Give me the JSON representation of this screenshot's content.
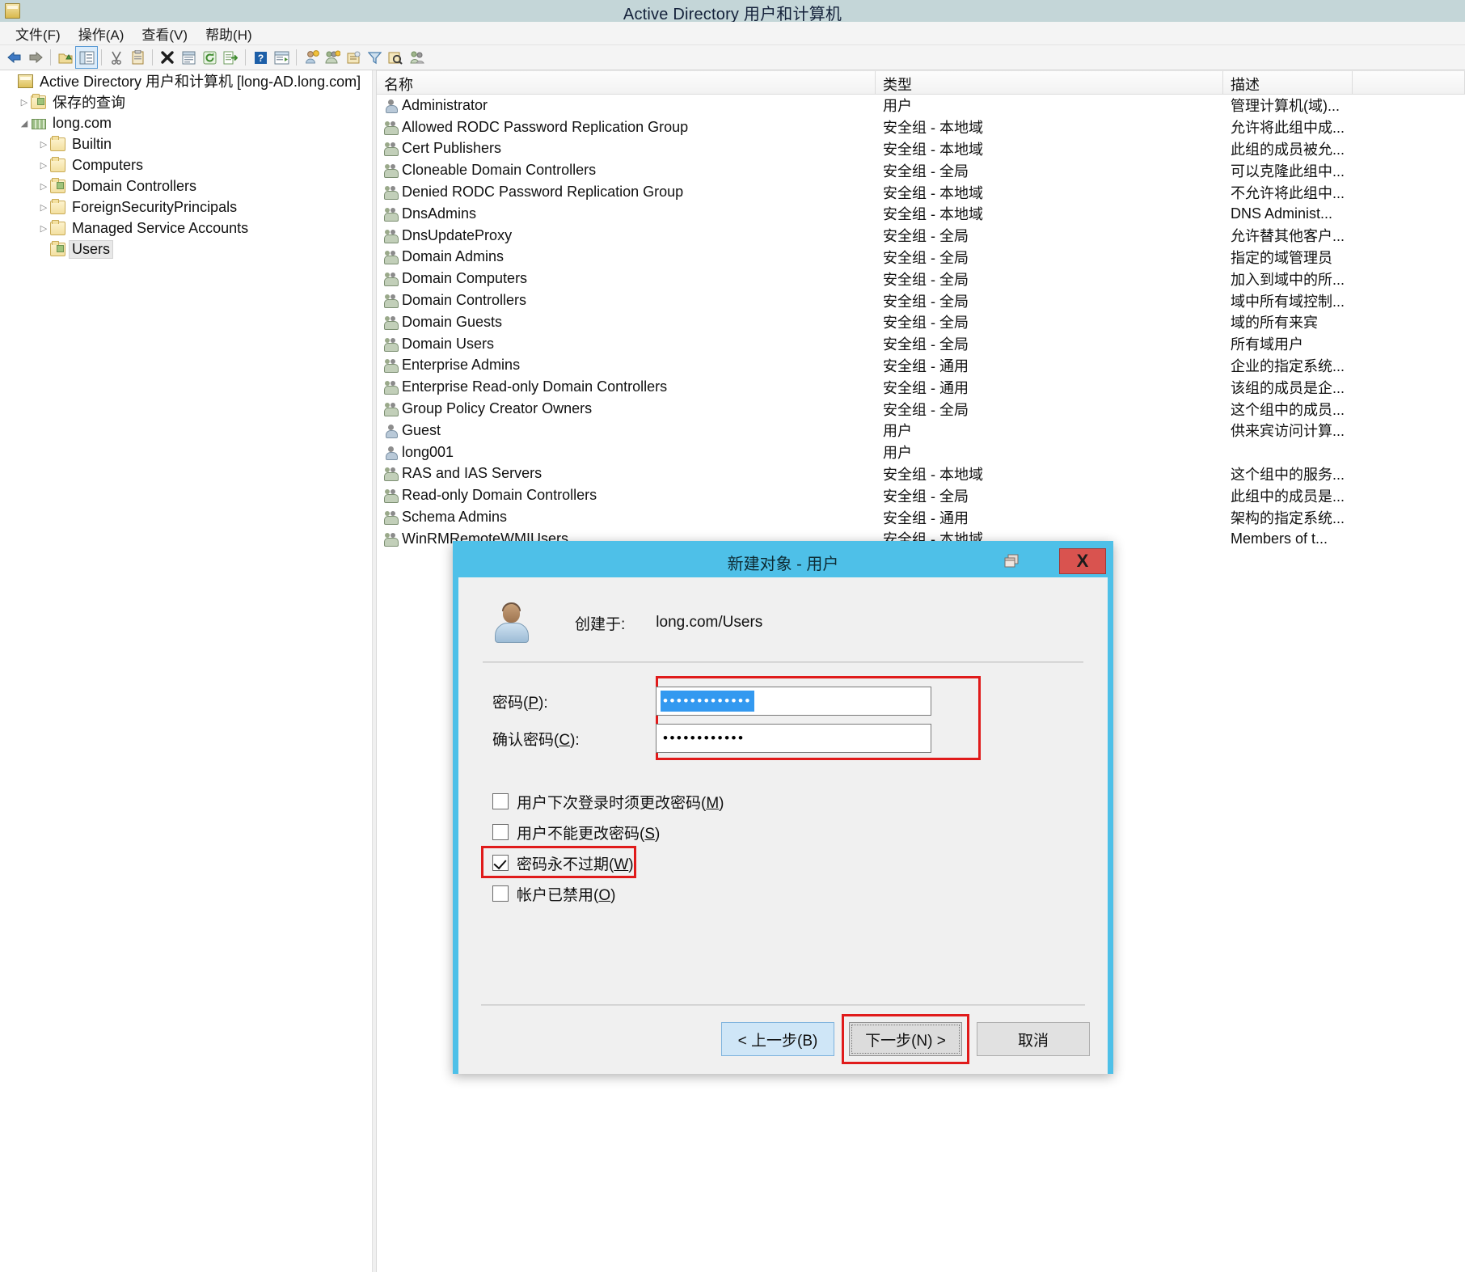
{
  "window": {
    "title": "Active Directory 用户和计算机",
    "icon": "console-icon"
  },
  "menubar": {
    "items": [
      {
        "label": "文件(F)",
        "name": "menu-file"
      },
      {
        "label": "操作(A)",
        "name": "menu-action"
      },
      {
        "label": "查看(V)",
        "name": "menu-view"
      },
      {
        "label": "帮助(H)",
        "name": "menu-help"
      }
    ]
  },
  "toolbar": {
    "buttons": [
      {
        "name": "back-icon",
        "title": "后退"
      },
      {
        "name": "forward-icon",
        "title": "前进"
      },
      {
        "name": "up-one-level-icon",
        "title": "向上一级"
      },
      {
        "name": "show-hide-tree-icon",
        "title": "显示/隐藏控制台树"
      },
      {
        "name": "cut-icon",
        "title": "剪切"
      },
      {
        "name": "copy-icon",
        "title": "复制"
      },
      {
        "name": "delete-icon",
        "title": "删除"
      },
      {
        "name": "properties-icon",
        "title": "属性"
      },
      {
        "name": "refresh-icon",
        "title": "刷新"
      },
      {
        "name": "export-list-icon",
        "title": "导出列表"
      },
      {
        "name": "help-icon",
        "title": "帮助"
      },
      {
        "name": "show-details-icon",
        "title": "显示详细信息"
      },
      {
        "name": "new-user-icon",
        "title": "新建用户"
      },
      {
        "name": "new-group-icon",
        "title": "新建组"
      },
      {
        "name": "new-ou-icon",
        "title": "新建组织单位"
      },
      {
        "name": "filter-icon",
        "title": "筛选"
      },
      {
        "name": "find-icon",
        "title": "查找"
      },
      {
        "name": "delegate-icon",
        "title": "委派控制"
      }
    ]
  },
  "tree": {
    "nodes": [
      {
        "label": "Active Directory 用户和计算机 [long-AD.long.com]",
        "indent": 0,
        "twist": "",
        "icon": "console",
        "selected": false,
        "name": "tree-node-root"
      },
      {
        "label": "保存的查询",
        "indent": 1,
        "twist": "▷",
        "icon": "folder special",
        "selected": false,
        "name": "tree-node-saved-queries"
      },
      {
        "label": "long.com",
        "indent": 1,
        "twist": "◢",
        "icon": "domain",
        "selected": false,
        "name": "tree-node-domain"
      },
      {
        "label": "Builtin",
        "indent": 2,
        "twist": "▷",
        "icon": "folder",
        "selected": false,
        "name": "tree-node-builtin"
      },
      {
        "label": "Computers",
        "indent": 2,
        "twist": "▷",
        "icon": "folder",
        "selected": false,
        "name": "tree-node-computers"
      },
      {
        "label": "Domain Controllers",
        "indent": 2,
        "twist": "▷",
        "icon": "folder special",
        "selected": false,
        "name": "tree-node-domain-controllers"
      },
      {
        "label": "ForeignSecurityPrincipals",
        "indent": 2,
        "twist": "▷",
        "icon": "folder",
        "selected": false,
        "name": "tree-node-foreign-security-principals"
      },
      {
        "label": "Managed Service Accounts",
        "indent": 2,
        "twist": "▷",
        "icon": "folder",
        "selected": false,
        "name": "tree-node-managed-service-accounts"
      },
      {
        "label": "Users",
        "indent": 2,
        "twist": "",
        "icon": "folder special",
        "selected": true,
        "name": "tree-node-users"
      }
    ]
  },
  "list": {
    "columns": [
      {
        "label": "名称",
        "name": "column-header-name"
      },
      {
        "label": "类型",
        "name": "column-header-type"
      },
      {
        "label": "描述",
        "name": "column-header-description"
      }
    ],
    "rows": [
      {
        "name": "Administrator",
        "icon": "user",
        "type": "用户",
        "desc": "管理计算机(域)..."
      },
      {
        "name": "Allowed RODC Password Replication Group",
        "icon": "group",
        "type": "安全组 - 本地域",
        "desc": "允许将此组中成..."
      },
      {
        "name": "Cert Publishers",
        "icon": "group",
        "type": "安全组 - 本地域",
        "desc": "此组的成员被允..."
      },
      {
        "name": "Cloneable Domain Controllers",
        "icon": "group",
        "type": "安全组 - 全局",
        "desc": "可以克隆此组中..."
      },
      {
        "name": "Denied RODC Password Replication Group",
        "icon": "group",
        "type": "安全组 - 本地域",
        "desc": "不允许将此组中..."
      },
      {
        "name": "DnsAdmins",
        "icon": "group",
        "type": "安全组 - 本地域",
        "desc": "DNS Administ..."
      },
      {
        "name": "DnsUpdateProxy",
        "icon": "group",
        "type": "安全组 - 全局",
        "desc": "允许替其他客户..."
      },
      {
        "name": "Domain Admins",
        "icon": "group",
        "type": "安全组 - 全局",
        "desc": "指定的域管理员"
      },
      {
        "name": "Domain Computers",
        "icon": "group",
        "type": "安全组 - 全局",
        "desc": "加入到域中的所..."
      },
      {
        "name": "Domain Controllers",
        "icon": "group",
        "type": "安全组 - 全局",
        "desc": "域中所有域控制..."
      },
      {
        "name": "Domain Guests",
        "icon": "group",
        "type": "安全组 - 全局",
        "desc": "域的所有来宾"
      },
      {
        "name": "Domain Users",
        "icon": "group",
        "type": "安全组 - 全局",
        "desc": "所有域用户"
      },
      {
        "name": "Enterprise Admins",
        "icon": "group",
        "type": "安全组 - 通用",
        "desc": "企业的指定系统..."
      },
      {
        "name": "Enterprise Read-only Domain Controllers",
        "icon": "group",
        "type": "安全组 - 通用",
        "desc": "该组的成员是企..."
      },
      {
        "name": "Group Policy Creator Owners",
        "icon": "group",
        "type": "安全组 - 全局",
        "desc": "这个组中的成员..."
      },
      {
        "name": "Guest",
        "icon": "user",
        "type": "用户",
        "desc": "供来宾访问计算..."
      },
      {
        "name": "long001",
        "icon": "user",
        "type": "用户",
        "desc": ""
      },
      {
        "name": "RAS and IAS Servers",
        "icon": "group",
        "type": "安全组 - 本地域",
        "desc": "这个组中的服务..."
      },
      {
        "name": "Read-only Domain Controllers",
        "icon": "group",
        "type": "安全组 - 全局",
        "desc": "此组中的成员是..."
      },
      {
        "name": "Schema Admins",
        "icon": "group",
        "type": "安全组 - 通用",
        "desc": "架构的指定系统..."
      },
      {
        "name": "WinRMRemoteWMIUsers__",
        "icon": "group",
        "type": "安全组 - 本地域",
        "desc": "Members of t..."
      }
    ]
  },
  "dialog": {
    "title": "新建对象 - 用户",
    "restore_icon": "restore-icon",
    "close_label": "X",
    "created_in_label": "创建于:",
    "created_in_value": "long.com/Users",
    "password": {
      "label": "密码(P):",
      "label_text": "密码(",
      "label_accel": "P",
      "label_tail": "):",
      "value": "•••••••••••••",
      "selected": true
    },
    "confirm_password": {
      "label": "确认密码(C):",
      "label_text": "确认密码(",
      "label_accel": "C",
      "label_tail": "):",
      "value": "••••••••••••",
      "selected": false
    },
    "checkboxes": [
      {
        "text": "用户下次登录时须更改密码(",
        "accel": "M",
        "tail": ")",
        "checked": false,
        "name": "checkbox-must-change-password"
      },
      {
        "text": "用户不能更改密码(",
        "accel": "S",
        "tail": ")",
        "checked": false,
        "name": "checkbox-cannot-change-password"
      },
      {
        "text": "密码永不过期(",
        "accel": "W",
        "tail": ")",
        "checked": true,
        "name": "checkbox-password-never-expires"
      },
      {
        "text": "帐户已禁用(",
        "accel": "O",
        "tail": ")",
        "checked": false,
        "name": "checkbox-account-disabled"
      }
    ],
    "buttons": {
      "back": "< 上一步(B)",
      "next": "下一步(N) >",
      "cancel": "取消"
    }
  },
  "colors": {
    "window_titlebar": "#c4d6d8",
    "dialog_accent": "#4ec0e8",
    "close_button": "#d9534f",
    "highlight_red": "#e01b1b",
    "selection_blue": "#3399f0"
  }
}
